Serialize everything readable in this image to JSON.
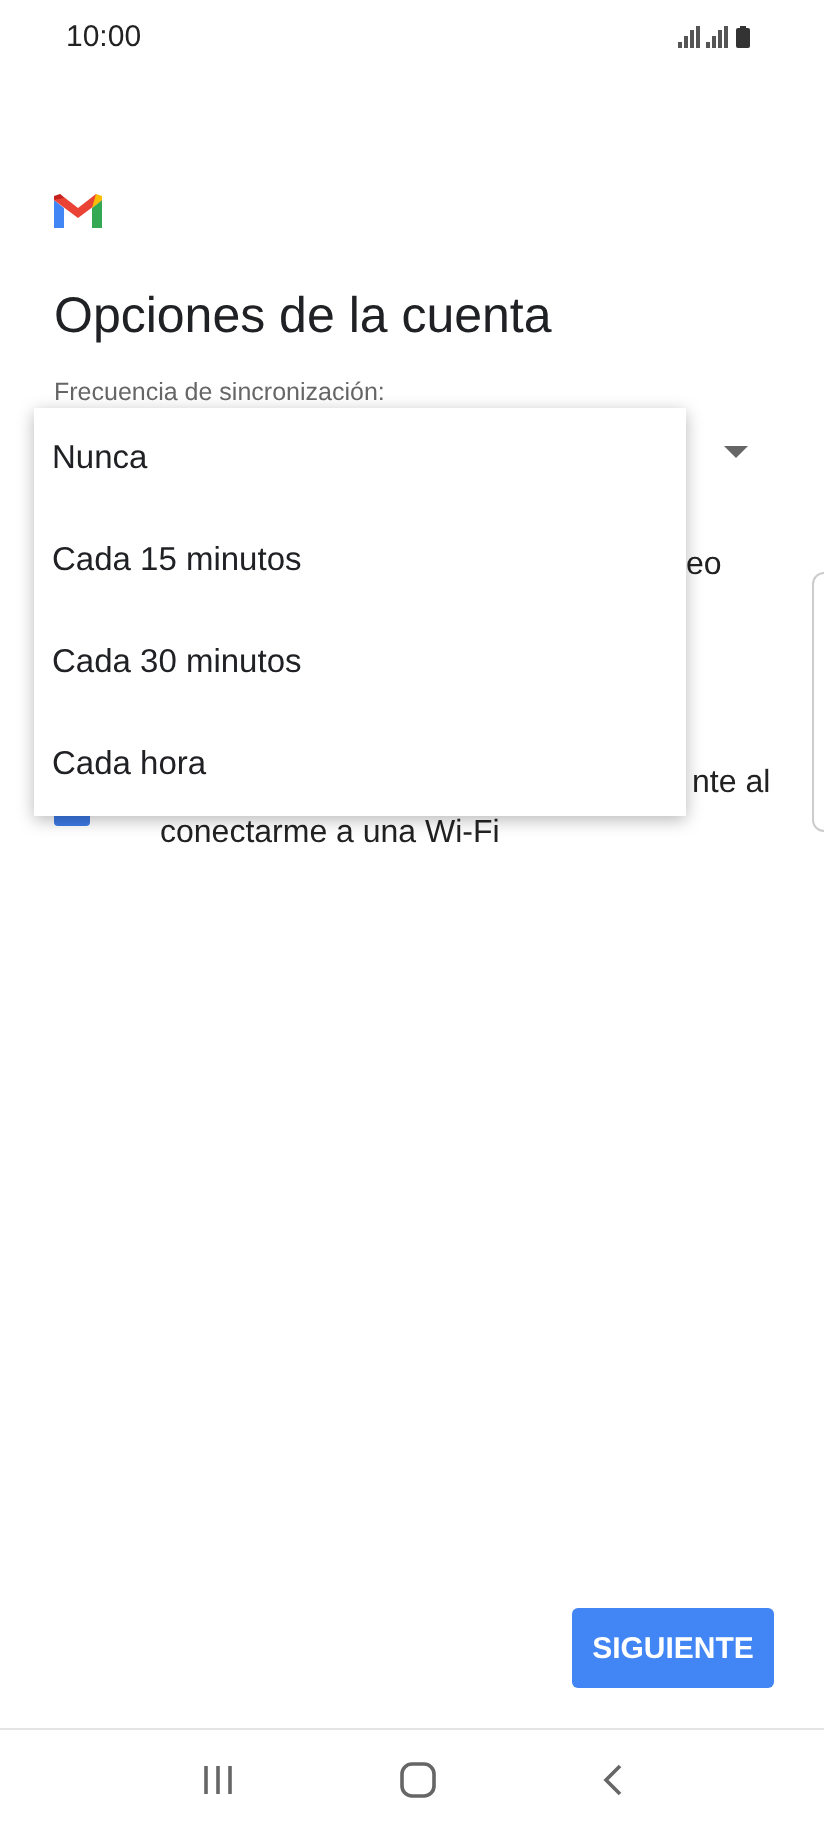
{
  "status_bar": {
    "time": "10:00"
  },
  "title": "Opciones de la cuenta",
  "sync_field": {
    "label": "Frecuencia de sincronización:"
  },
  "options": [
    {
      "text_end": "eo"
    },
    {
      "text_end": "nte al",
      "text_line_2": "conectarme a una Wi-Fi",
      "checked": true
    }
  ],
  "dropdown_menu": {
    "items": [
      {
        "label": "Nunca"
      },
      {
        "label": "Cada 15 minutos"
      },
      {
        "label": "Cada 30 minutos"
      },
      {
        "label": "Cada hora"
      }
    ]
  },
  "next_button": "SIGUIENTE"
}
